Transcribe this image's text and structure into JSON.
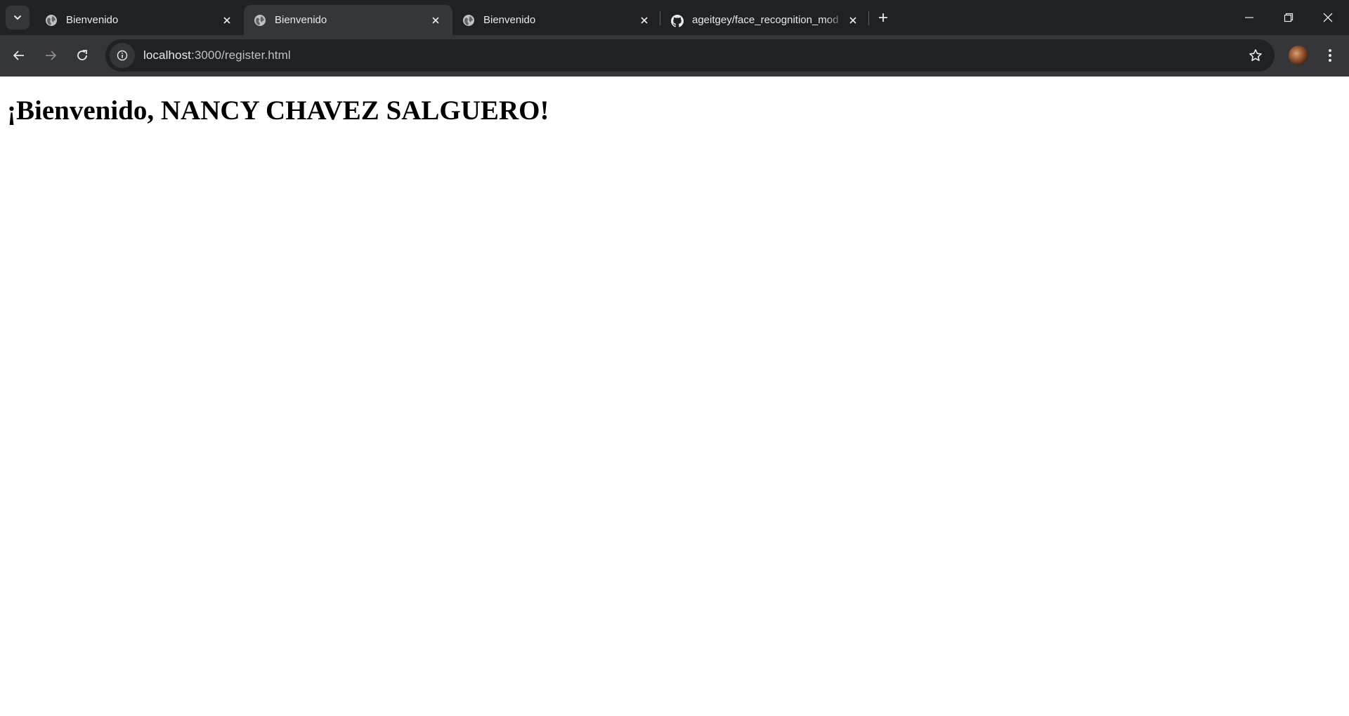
{
  "browser": {
    "tabs": [
      {
        "title": "Bienvenido",
        "icon": "globe-icon",
        "active": false
      },
      {
        "title": "Bienvenido",
        "icon": "globe-icon",
        "active": true
      },
      {
        "title": "Bienvenido",
        "icon": "globe-icon",
        "active": false
      },
      {
        "title": "ageitgey/face_recognition_mod",
        "icon": "github-icon",
        "active": false
      }
    ],
    "url_host": "localhost",
    "url_rest": ":3000/register.html"
  },
  "page": {
    "heading": "¡Bienvenido, NANCY CHAVEZ SALGUERO!"
  },
  "colors": {
    "chrome_bg": "#202124",
    "toolbar_bg": "#35363a",
    "text": "#e8eaed"
  }
}
